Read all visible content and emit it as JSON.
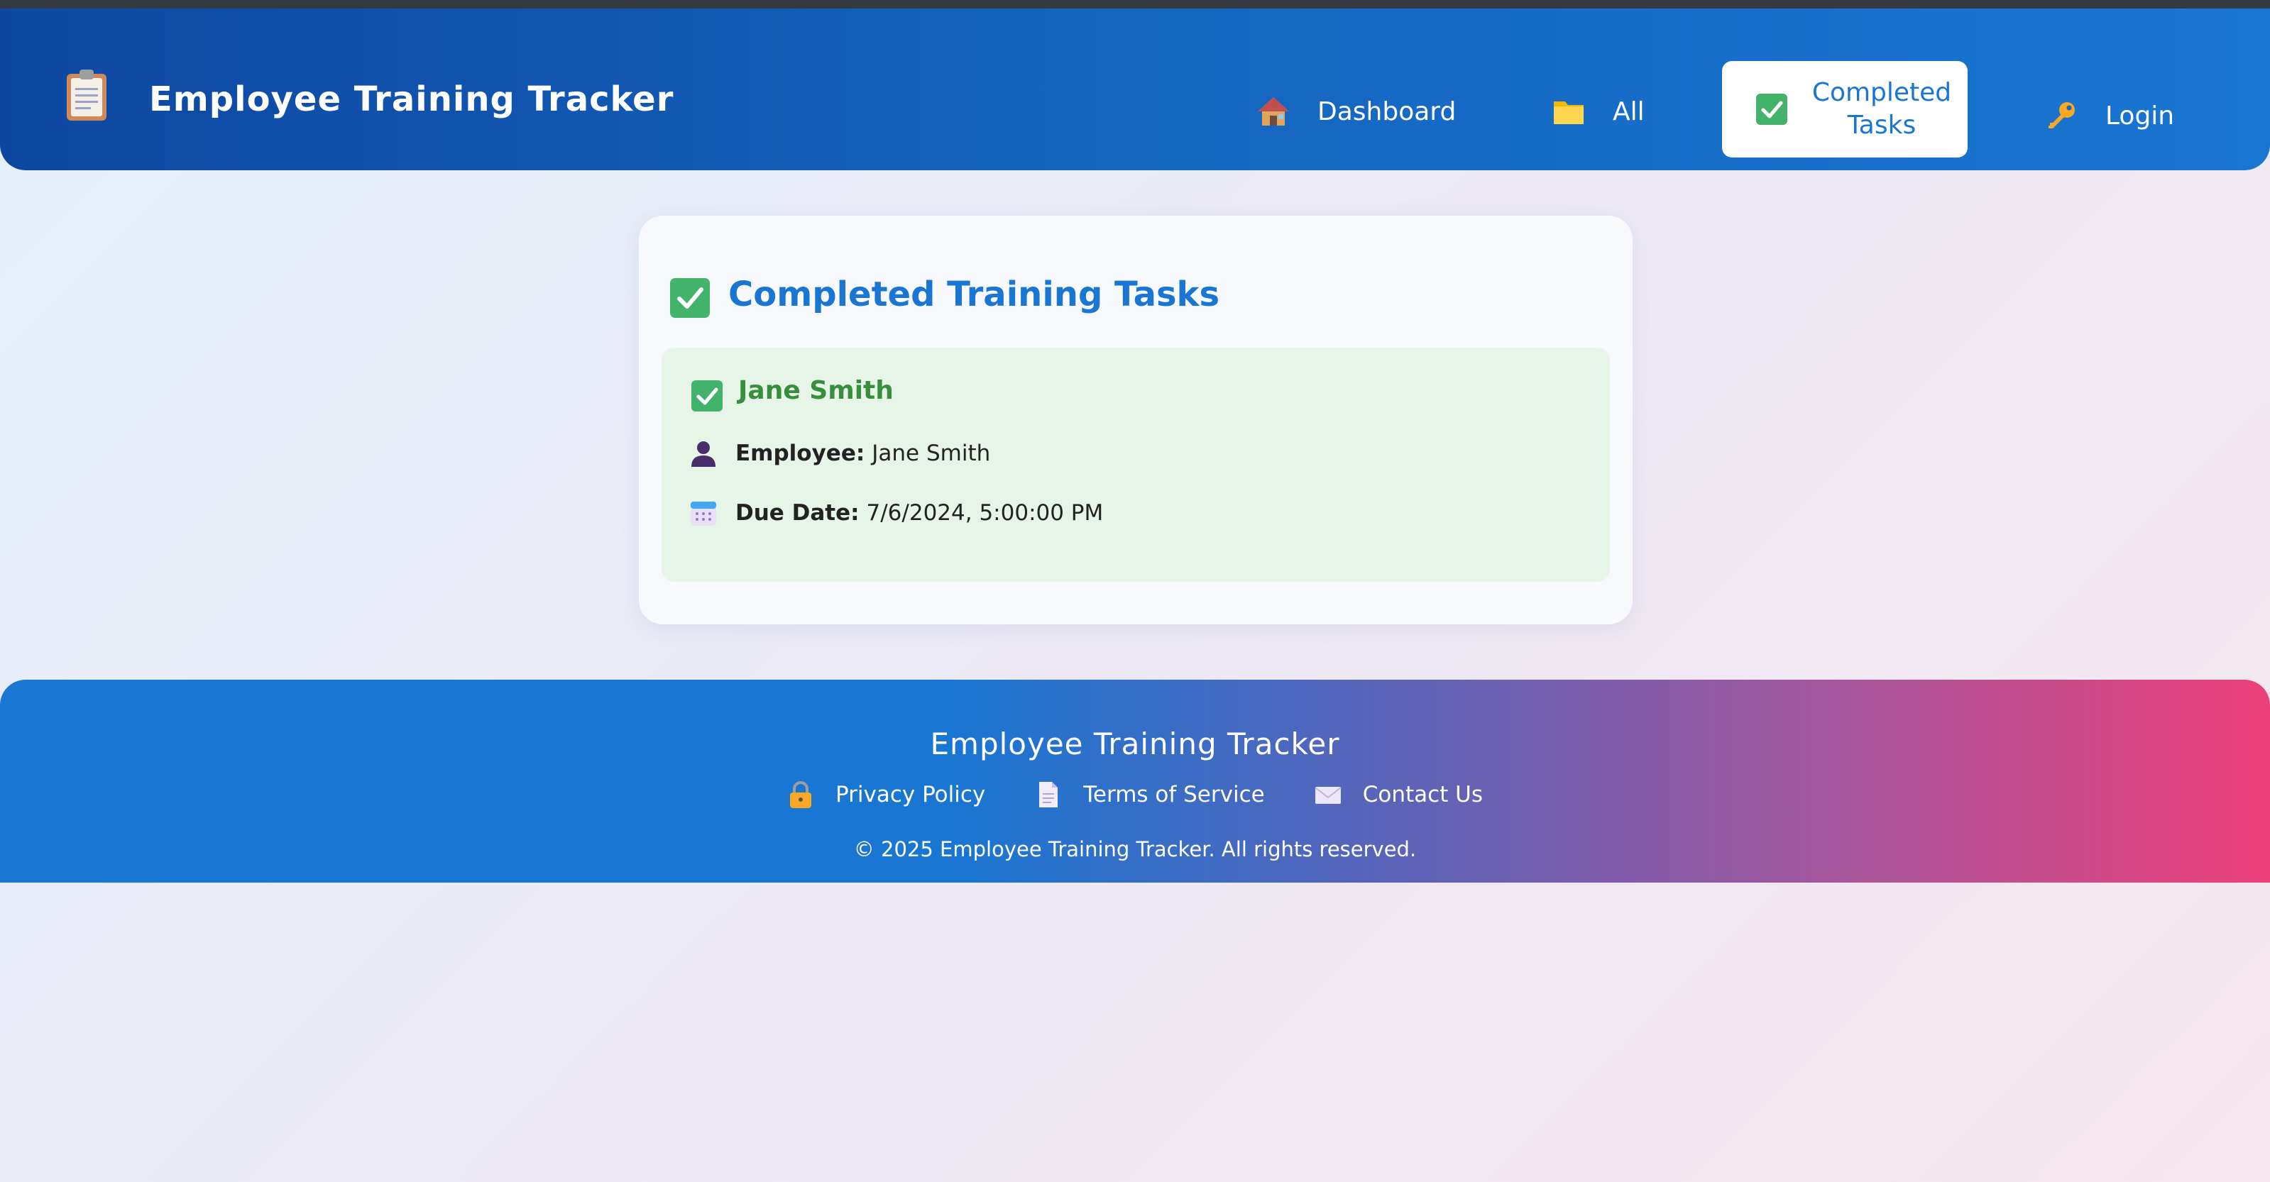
{
  "header": {
    "title": "Employee Training Tracker",
    "brand_icon": "clipboard-icon",
    "nav": [
      {
        "label": "Dashboard",
        "icon": "house-icon"
      },
      {
        "label": "All",
        "icon": "folder-icon"
      },
      {
        "label": "Completed Tasks",
        "icon": "check-box-icon",
        "active": true
      },
      {
        "label": "Login",
        "icon": "key-icon"
      }
    ]
  },
  "main": {
    "title": "Completed Training Tasks",
    "title_icon": "check-box-icon",
    "task": {
      "name": "Jane Smith",
      "employee_label": "Employee:",
      "employee_value": "Jane Smith",
      "due_label": "Due Date:",
      "due_value": "7/6/2024, 5:00:00 PM"
    }
  },
  "footer": {
    "title": "Employee Training Tracker",
    "links": [
      {
        "label": "Privacy Policy",
        "icon": "lock-icon"
      },
      {
        "label": "Terms of Service",
        "icon": "document-icon"
      },
      {
        "label": "Contact Us",
        "icon": "envelope-icon"
      }
    ],
    "copyright": "© 2025 Employee Training Tracker. All rights reserved."
  },
  "colors": {
    "header_start": "#0d47a1",
    "header_end": "#1976d2",
    "accent": "#1976d2",
    "success": "#388e3c",
    "footer_end": "#ec407a"
  }
}
